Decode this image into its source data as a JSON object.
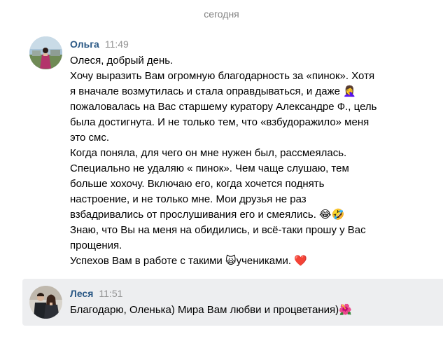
{
  "date_divider": "сегодня",
  "messages": [
    {
      "author": "Ольга",
      "time": "11:49",
      "lines": [
        "Олеся, добрый день.",
        "Хочу выразить Вам огромную благодарность за «пинок». Хотя",
        "я вначале возмутилась и стала оправдываться, и даже 🤦‍♀️",
        "пожаловалась на Вас старшему куратору Александре Ф., цель",
        "была достигнута. И не только тем, что «взбудоражило» меня",
        "это смс.",
        "Когда поняла, для чего он мне нужен был, рассмеялась.",
        "Специально не удаляю « пинок». Чем чаще слушаю, тем",
        "больше хохочу. Включаю его, когда хочется поднять",
        "настроение, и не только мне. Мои друзья не раз",
        "взбадривались от прослушивания его и смеялись. 😂🤣",
        "Знаю, что Вы на меня на обидились, и всё-таки прошу у Вас",
        "прощения.",
        "Успехов Вам в работе с такими 🙀учениками. ❤️"
      ]
    },
    {
      "author": "Леся",
      "time": "11:51",
      "lines": [
        "Благодарю, Оленька) Мира Вам любви и процветания)🌺"
      ]
    }
  ],
  "colors": {
    "author": "#2a5885",
    "time": "#939393",
    "date": "#828282",
    "highlight_bg": "#edeef0"
  }
}
